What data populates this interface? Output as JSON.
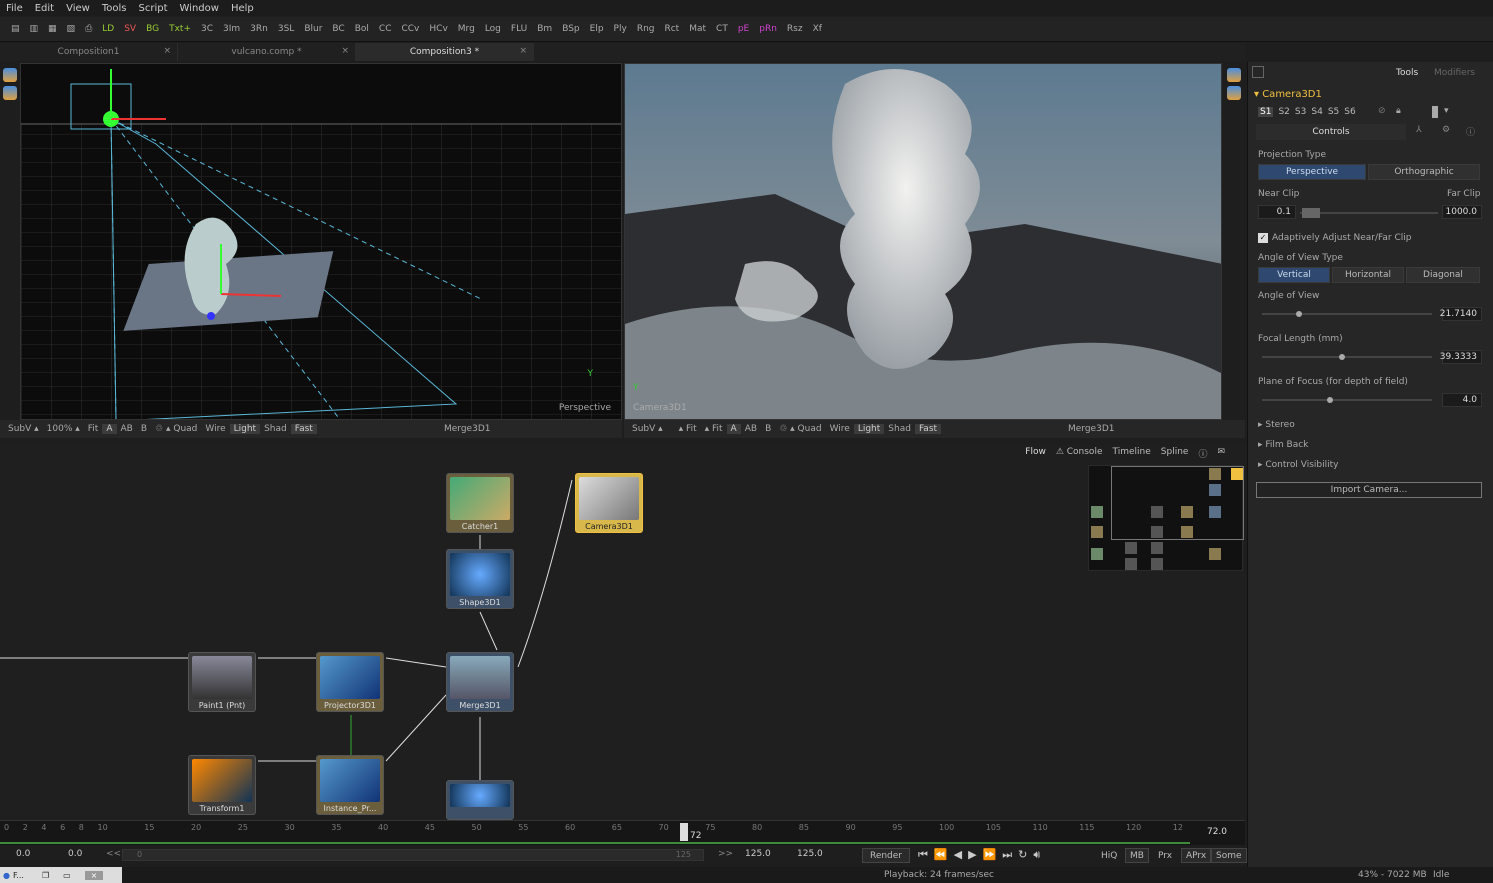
{
  "menu": [
    "File",
    "Edit",
    "View",
    "Tools",
    "Script",
    "Window",
    "Help"
  ],
  "toolbar": [
    "LD",
    "SV",
    "BG",
    "Txt+",
    "3C",
    "3Im",
    "3Rn",
    "3SL",
    "Blur",
    "BC",
    "Bol",
    "CC",
    "CCv",
    "HCv",
    "Mrg",
    "Log",
    "FLU",
    "Bm",
    "BSp",
    "Elp",
    "Ply",
    "Rng",
    "Rct",
    "Mat",
    "CT",
    "pE",
    "pRn",
    "Rsz",
    "Xf"
  ],
  "tabs": [
    {
      "label": "Composition1",
      "close": "×"
    },
    {
      "label": "vulcano.comp *",
      "close": "×"
    },
    {
      "label": "Composition3 *",
      "close": "×"
    }
  ],
  "viewer_left": {
    "label": "Perspective",
    "axis_y": "Y",
    "bar": [
      "SubV ▴",
      "100% ▴",
      "Fit",
      "A",
      "AB",
      "B",
      "♲ ▴ Quad",
      "Wire",
      "Light",
      "Shad",
      "Fast"
    ],
    "title": "Merge3D1"
  },
  "viewer_right": {
    "label": "Camera3D1",
    "axis_y": "Y",
    "bar": [
      "SubV ▴",
      "",
      "▴ Fit",
      "▴ Fit",
      "A",
      "AB",
      "B",
      "♲ ▴ Quad",
      "Wire",
      "Light",
      "Shad",
      "Fast"
    ],
    "title": "Merge3D1"
  },
  "flow_tabs": [
    "Flow",
    "Console",
    "Timeline",
    "Spline"
  ],
  "nodes": [
    {
      "name": "Catcher1"
    },
    {
      "name": "Camera3D1"
    },
    {
      "name": "Shape3D1"
    },
    {
      "name": "Paint1 (Pnt)"
    },
    {
      "name": "Projector3D1"
    },
    {
      "name": "Merge3D1"
    },
    {
      "name": "Transform1"
    },
    {
      "name": "Instance_Pr..."
    }
  ],
  "panel": {
    "tabs": [
      "Tools",
      "Modifiers"
    ],
    "tool_name": "Camera3D1",
    "slots": [
      "S1",
      "S2",
      "S3",
      "S4",
      "S5",
      "S6"
    ],
    "controls_tab": "Controls",
    "projection_type_label": "Projection Type",
    "projection_options": [
      "Perspective",
      "Orthographic"
    ],
    "near_clip_label": "Near Clip",
    "far_clip_label": "Far Clip",
    "near_clip": "0.1",
    "far_clip": "1000.0",
    "adaptive_label": "Adaptively Adjust Near/Far Clip",
    "aov_type_label": "Angle of View Type",
    "aov_options": [
      "Vertical",
      "Horizontal",
      "Diagonal"
    ],
    "aov_label": "Angle of View",
    "aov_value": "21.7140",
    "aov_level": 0.2,
    "focal_label": "Focal Length (mm)",
    "focal_value": "39.3333",
    "focal_level": 0.45,
    "focus_label": "Plane of Focus (for depth of field)",
    "focus_value": "4.0",
    "focus_level": 0.38,
    "sections": [
      "Stereo",
      "Film Back",
      "Control Visibility"
    ],
    "import_button": "Import Camera..."
  },
  "timeline": {
    "ticks": [
      "0",
      "2",
      "4",
      "6",
      "8",
      "10",
      "15",
      "20",
      "25",
      "30",
      "35",
      "40",
      "45",
      "50",
      "55",
      "60",
      "65",
      "70",
      "75",
      "80",
      "85",
      "90",
      "95",
      "100",
      "105",
      "110",
      "115",
      "120",
      "12"
    ],
    "current": "72",
    "current_frame": "72.0"
  },
  "transport": {
    "start": "0.0",
    "render_start": "0.0",
    "rewind": "<<",
    "range_start": "0",
    "range_end": "125",
    "ff": ">>",
    "render_end": "125.0",
    "end": "125.0",
    "render": "Render",
    "buttons": [
      "HiQ",
      "MB",
      "Prx",
      "APrx",
      "Some"
    ]
  },
  "status": {
    "playback": "Playback: 24 frames/sec",
    "memory": "43% - 7022 MB",
    "state": "Idle",
    "task": "F..."
  },
  "colors": {
    "accent": "#f0c040",
    "select": "#2f4870"
  }
}
